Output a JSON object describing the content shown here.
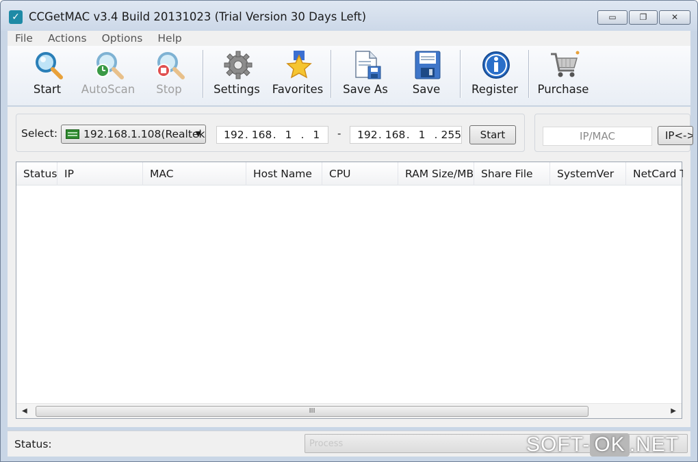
{
  "window": {
    "title": "CCGetMAC v3.4 Build 20131023 (Trial Version 30 Days Left)",
    "controls": {
      "minimize": "▭",
      "maximize": "❐",
      "close": "✕"
    }
  },
  "menu": [
    "File",
    "Actions",
    "Options",
    "Help"
  ],
  "toolbar": {
    "buttons": [
      {
        "label": "Start",
        "icon": "magnifier-icon",
        "enabled": true
      },
      {
        "label": "AutoScan",
        "icon": "magnifier-clock-icon",
        "enabled": false
      },
      {
        "label": "Stop",
        "icon": "magnifier-stop-icon",
        "enabled": false
      },
      {
        "label": "Settings",
        "icon": "gear-icon",
        "enabled": true
      },
      {
        "label": "Favorites",
        "icon": "star-icon",
        "enabled": true
      },
      {
        "label": "Save As",
        "icon": "save-as-icon",
        "enabled": true
      },
      {
        "label": "Save",
        "icon": "floppy-icon",
        "enabled": true
      },
      {
        "label": "Register",
        "icon": "info-icon",
        "enabled": true
      },
      {
        "label": "Purchase",
        "icon": "cart-icon",
        "enabled": true
      }
    ]
  },
  "scan": {
    "select_label": "Select:",
    "adapter": "192.168.1.108(Realtek",
    "range_from": [
      "192",
      "168",
      "1",
      "1"
    ],
    "range_sep": "-",
    "range_to": [
      "192",
      "168",
      "1",
      "255"
    ],
    "start_button": "Start",
    "ipmac_placeholder": "IP/MAC",
    "ipmac_button": "IP<->I"
  },
  "table": {
    "columns": [
      "Status",
      "IP",
      "MAC",
      "Host Name",
      "CPU",
      "RAM Size/MB",
      "Share File",
      "SystemVer",
      "NetCard T."
    ],
    "rows": [],
    "scroll_grip": "III"
  },
  "status": {
    "label": "Status:",
    "progress_text": "Process"
  },
  "watermark": {
    "left": "SOFT-",
    "ok": "OK",
    "right": ".NET"
  },
  "colors": {
    "title_bar": "#ccd8e8",
    "accent_blue": "#2a6fc9",
    "window_bg": "#f0f0f0"
  }
}
